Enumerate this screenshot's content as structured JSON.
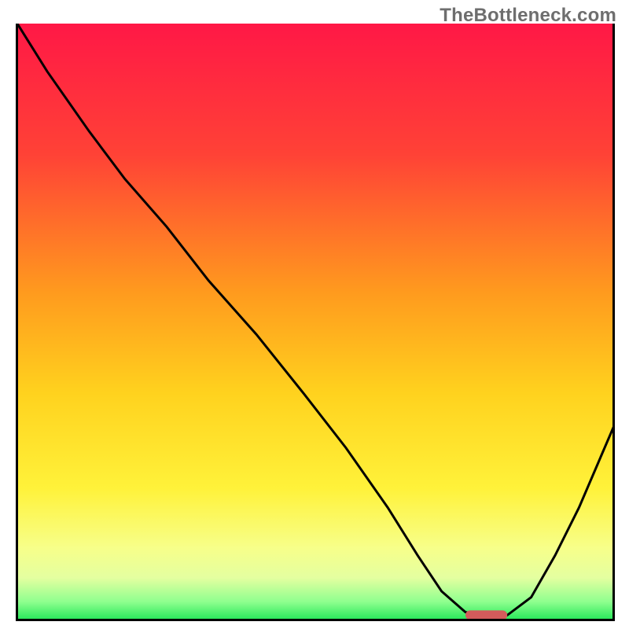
{
  "watermark": "TheBottleneck.com",
  "chart_data": {
    "type": "line",
    "title": "",
    "xlabel": "",
    "ylabel": "",
    "xlim": [
      0,
      100
    ],
    "ylim": [
      0,
      100
    ],
    "x": [
      0,
      5,
      12,
      18,
      25,
      32,
      40,
      48,
      55,
      62,
      67,
      71,
      75,
      78,
      82,
      86,
      90,
      94,
      100
    ],
    "values": [
      100,
      92,
      82,
      74,
      66,
      57,
      48,
      38,
      29,
      19,
      11,
      5,
      1.5,
      1,
      1,
      4,
      11,
      19,
      33
    ],
    "marker": {
      "x_start": 75,
      "x_end": 82,
      "y": 1
    },
    "gradient_stops": [
      {
        "off": 0.0,
        "color": "#ff1846"
      },
      {
        "off": 0.22,
        "color": "#ff4236"
      },
      {
        "off": 0.45,
        "color": "#ff9a1e"
      },
      {
        "off": 0.62,
        "color": "#ffd21e"
      },
      {
        "off": 0.78,
        "color": "#fff23a"
      },
      {
        "off": 0.88,
        "color": "#f7ff8a"
      },
      {
        "off": 0.93,
        "color": "#e4ffa0"
      },
      {
        "off": 0.97,
        "color": "#8fff8f"
      },
      {
        "off": 1.0,
        "color": "#28e85a"
      }
    ],
    "colors": {
      "curve": "#000000",
      "marker": "#d35b5b",
      "frame": "#000000"
    }
  }
}
